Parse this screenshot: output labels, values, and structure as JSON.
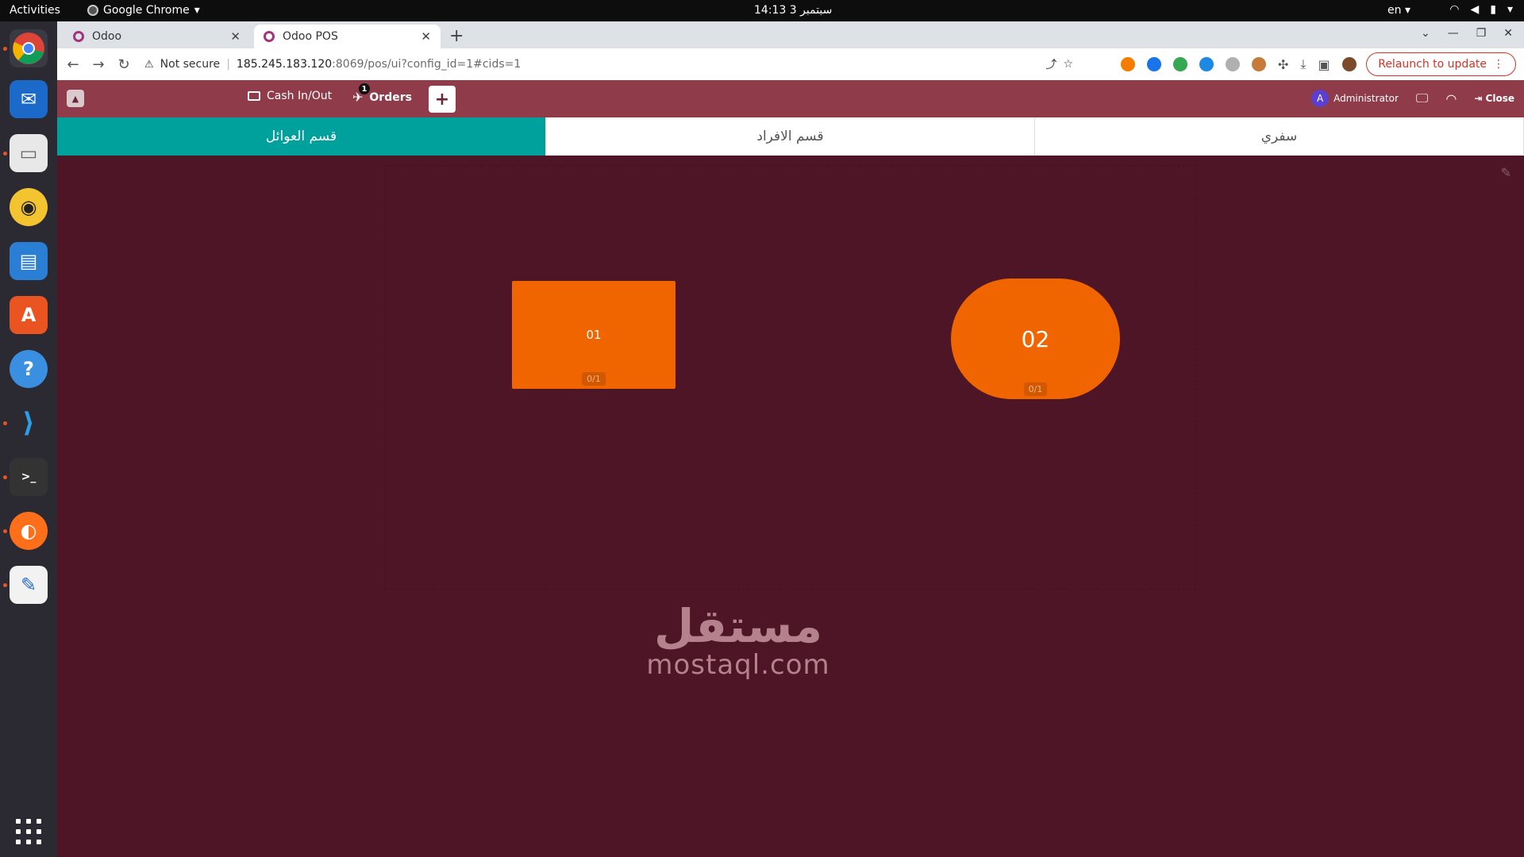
{
  "system_bar": {
    "activities": "Activities",
    "app_name": "Google Chrome",
    "clock": "14:13  3 سبتمبر",
    "language": "en"
  },
  "dock": {
    "apps": [
      "chrome",
      "thunderbird",
      "files",
      "rhythmbox",
      "libreoffice-writer",
      "app-center",
      "help",
      "vscode",
      "terminal",
      "firefox",
      "text-editor"
    ]
  },
  "browser": {
    "tabs": [
      {
        "label": "Odoo",
        "active": false
      },
      {
        "label": "Odoo POS",
        "active": true
      }
    ],
    "security_label": "Not secure",
    "url_host": "185.245.183.120",
    "url_path": ":8069/pos/ui?config_id=1#cids=1",
    "relaunch_label": "Relaunch to update"
  },
  "pos_header": {
    "cash_label": "Cash In/Out",
    "orders_label": "Orders",
    "orders_badge": "1",
    "add_label": "+",
    "user_initial": "A",
    "user_name": "Administrator",
    "close_label": "Close"
  },
  "floors": [
    {
      "label": "قسم العوائل",
      "active": true
    },
    {
      "label": "قسم الافراد",
      "active": false
    },
    {
      "label": "سفري",
      "active": false
    }
  ],
  "tables": [
    {
      "name": "01",
      "seats": "0/1",
      "shape": "square"
    },
    {
      "name": "02",
      "seats": "0/1",
      "shape": "round"
    }
  ],
  "colors": {
    "header": "#8f3b4a",
    "floor_bg": "#4e1526",
    "active_floor": "#00a09d",
    "table": "#f06500"
  },
  "watermark": {
    "arabic": "مستقل",
    "latin": "mostaql.com"
  }
}
